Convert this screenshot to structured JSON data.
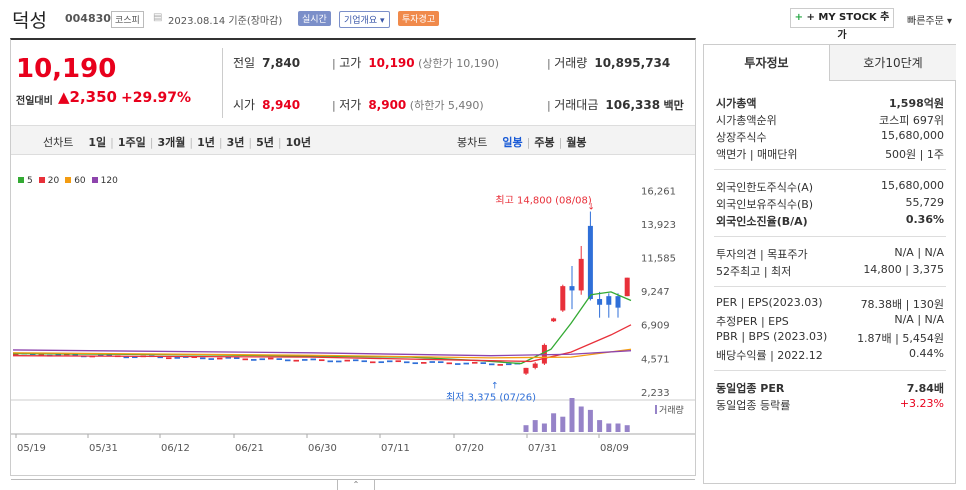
{
  "header": {
    "name": "덕성",
    "code": "004830",
    "market": "코스피",
    "date_text": "2023.08.14 기준(장마감)",
    "realtime": "실시간",
    "company_overview": "기업개요",
    "warning": "투자경고",
    "mystock_btn": "+ MY STOCK 추가",
    "quick_order": "빠른주문"
  },
  "price": {
    "current": "10,190",
    "change_label": "전일대비",
    "change_amt": "2,350",
    "change_pct": "+29.97%"
  },
  "stats": {
    "prev_label": "전일",
    "prev": "7,840",
    "high_label": "고가",
    "high": "10,190",
    "high_limit": "(상한가 10,190)",
    "volume_label": "거래량",
    "volume": "10,895,734",
    "open_label": "시가",
    "open": "8,940",
    "low_label": "저가",
    "low": "8,900",
    "low_limit": "(하한가 5,490)",
    "amount_label": "거래대금",
    "amount": "106,338",
    "amount_unit": "백만"
  },
  "periods": {
    "line": "선차트",
    "items": [
      "1일",
      "1주일",
      "3개월",
      "1년",
      "3년",
      "5년",
      "10년"
    ],
    "candle": "봉차트",
    "candle_items": [
      "일봉",
      "주봉",
      "월봉"
    ]
  },
  "legend": [
    {
      "label": "5",
      "color": "#33aa33"
    },
    {
      "label": "20",
      "color": "#e8303a"
    },
    {
      "label": "60",
      "color": "#f39c12"
    },
    {
      "label": "120",
      "color": "#8e44ad"
    }
  ],
  "chart_data": {
    "type": "candlestick",
    "y_ticks": [
      "16,261",
      "13,923",
      "11,585",
      "9,247",
      "6,909",
      "4,571",
      "2,233"
    ],
    "x_ticks": [
      "05/19",
      "05/31",
      "06/12",
      "06/21",
      "06/30",
      "07/11",
      "07/20",
      "07/31",
      "08/09"
    ],
    "max_label": "최고 14,800 (08/08)",
    "min_label": "최저 3,375 (07/26)",
    "volume_label": "거래량",
    "recent_candles": [
      {
        "o": 3500,
        "c": 3900,
        "h": 3900,
        "l": 3400,
        "up": true
      },
      {
        "o": 3900,
        "c": 4200,
        "h": 4300,
        "l": 3800,
        "up": true
      },
      {
        "o": 4200,
        "c": 5500,
        "h": 5600,
        "l": 4100,
        "up": true
      },
      {
        "o": 7150,
        "c": 7350,
        "h": 7400,
        "l": 7100,
        "up": true
      },
      {
        "o": 7900,
        "c": 9600,
        "h": 9700,
        "l": 7800,
        "up": true
      },
      {
        "o": 9600,
        "c": 9300,
        "h": 11000,
        "l": 8000,
        "up": false
      },
      {
        "o": 9300,
        "c": 11500,
        "h": 12400,
        "l": 9000,
        "up": true
      },
      {
        "o": 13800,
        "c": 8700,
        "h": 14800,
        "l": 8600,
        "up": false
      },
      {
        "o": 8700,
        "c": 8300,
        "h": 9200,
        "l": 7400,
        "up": false
      },
      {
        "o": 8300,
        "c": 8900,
        "h": 9100,
        "l": 7400,
        "up": false
      },
      {
        "o": 8900,
        "c": 8100,
        "h": 9100,
        "l": 7400,
        "up": false
      },
      {
        "o": 8900,
        "c": 10190,
        "h": 10190,
        "l": 8900,
        "up": true
      }
    ]
  },
  "side": {
    "tab1": "투자정보",
    "tab2": "호가10단계",
    "rows1": [
      {
        "k": "시가총액",
        "v": "1,598억원",
        "bold": true
      },
      {
        "k": "시가총액순위",
        "v": "코스피 697위"
      },
      {
        "k": "상장주식수",
        "v": "15,680,000"
      },
      {
        "k": "액면가 | 매매단위",
        "v": "500원 | 1주"
      }
    ],
    "rows2": [
      {
        "k": "외국인한도주식수(A)",
        "v": "15,680,000"
      },
      {
        "k": "외국인보유주식수(B)",
        "v": "55,729"
      },
      {
        "k": "외국인소진율(B/A)",
        "v": "0.36%",
        "bold": true
      }
    ],
    "rows3": [
      {
        "k": "투자의견 | 목표주가",
        "v": "N/A | N/A"
      },
      {
        "k": "52주최고 | 최저",
        "v": "14,800 | 3,375"
      }
    ],
    "rows4": [
      {
        "k": "PER | EPS(2023.03)",
        "v": "78.38배 | 130원"
      },
      {
        "k": "추정PER | EPS",
        "v": "N/A | N/A"
      },
      {
        "k": "PBR | BPS (2023.03)",
        "v": "1.87배 | 5,454원"
      },
      {
        "k": "배당수익률 | 2022.12",
        "v": "0.44%"
      }
    ],
    "rows5": [
      {
        "k": "동일업종 PER",
        "v": "7.84배",
        "bold": true
      },
      {
        "k": "동일업종 등락률",
        "v": "+3.23%",
        "red": true
      }
    ]
  }
}
